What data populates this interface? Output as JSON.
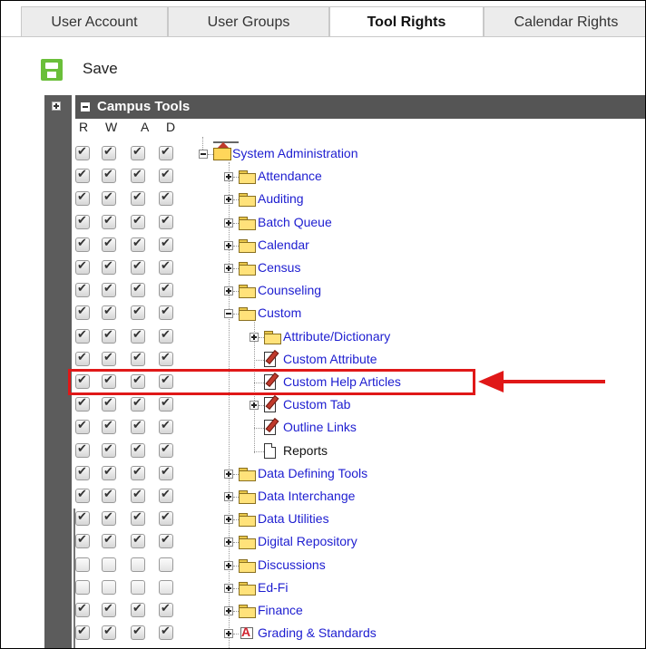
{
  "tabs": [
    {
      "label": "User Account",
      "active": false
    },
    {
      "label": "User Groups",
      "active": false
    },
    {
      "label": "Tool Rights",
      "active": true
    },
    {
      "label": "Calendar Rights",
      "active": false
    }
  ],
  "toolbar": {
    "save_label": "Save",
    "save_icon": "save-icon"
  },
  "section": {
    "title": "Campus Tools"
  },
  "columns": [
    "R",
    "W",
    "A",
    "D"
  ],
  "colors": {
    "link": "#1d1dd0",
    "header_bg": "#555555",
    "highlight": "#e01818",
    "save_green": "#6abf3a"
  },
  "tree": [
    {
      "label": "System Administration",
      "icon": "admin-folder-icon",
      "level": 0,
      "expander": "minus",
      "checked": true
    },
    {
      "label": "Attendance",
      "icon": "folder-icon",
      "level": 1,
      "expander": "plus",
      "checked": true
    },
    {
      "label": "Auditing",
      "icon": "folder-icon",
      "level": 1,
      "expander": "plus",
      "checked": true
    },
    {
      "label": "Batch Queue",
      "icon": "folder-icon",
      "level": 1,
      "expander": "plus",
      "checked": true
    },
    {
      "label": "Calendar",
      "icon": "folder-icon",
      "level": 1,
      "expander": "plus",
      "checked": true
    },
    {
      "label": "Census",
      "icon": "folder-icon",
      "level": 1,
      "expander": "plus",
      "checked": true
    },
    {
      "label": "Counseling",
      "icon": "folder-icon",
      "level": 1,
      "expander": "plus",
      "checked": true
    },
    {
      "label": "Custom",
      "icon": "folder-icon",
      "level": 1,
      "expander": "minus",
      "checked": true
    },
    {
      "label": "Attribute/Dictionary",
      "icon": "folder-icon",
      "level": 2,
      "expander": "plus",
      "checked": true
    },
    {
      "label": "Custom Attribute",
      "icon": "edit-document-icon",
      "level": 2,
      "expander": "none",
      "checked": true
    },
    {
      "label": "Custom Help Articles",
      "icon": "edit-document-icon",
      "level": 2,
      "expander": "none",
      "checked": true,
      "highlighted": true
    },
    {
      "label": "Custom Tab",
      "icon": "edit-document-icon",
      "level": 2,
      "expander": "plus",
      "checked": true
    },
    {
      "label": "Outline Links",
      "icon": "edit-document-icon",
      "level": 2,
      "expander": "none",
      "checked": true
    },
    {
      "label": "Reports",
      "icon": "document-icon",
      "level": 2,
      "expander": "none",
      "checked": true,
      "dark": true
    },
    {
      "label": "Data Defining Tools",
      "icon": "folder-icon",
      "level": 1,
      "expander": "plus",
      "checked": true
    },
    {
      "label": "Data Interchange",
      "icon": "folder-icon",
      "level": 1,
      "expander": "plus",
      "checked": true
    },
    {
      "label": "Data Utilities",
      "icon": "folder-icon",
      "level": 1,
      "expander": "plus",
      "checked": true
    },
    {
      "label": "Digital Repository",
      "icon": "folder-icon",
      "level": 1,
      "expander": "plus",
      "checked": true
    },
    {
      "label": "Discussions",
      "icon": "folder-icon",
      "level": 1,
      "expander": "plus",
      "checked": false
    },
    {
      "label": "Ed-Fi",
      "icon": "folder-icon",
      "level": 1,
      "expander": "plus",
      "checked": false
    },
    {
      "label": "Finance",
      "icon": "folder-icon",
      "level": 1,
      "expander": "plus",
      "checked": true
    },
    {
      "label": "Grading & Standards",
      "icon": "grading-icon",
      "level": 1,
      "expander": "plus",
      "checked": true
    }
  ]
}
